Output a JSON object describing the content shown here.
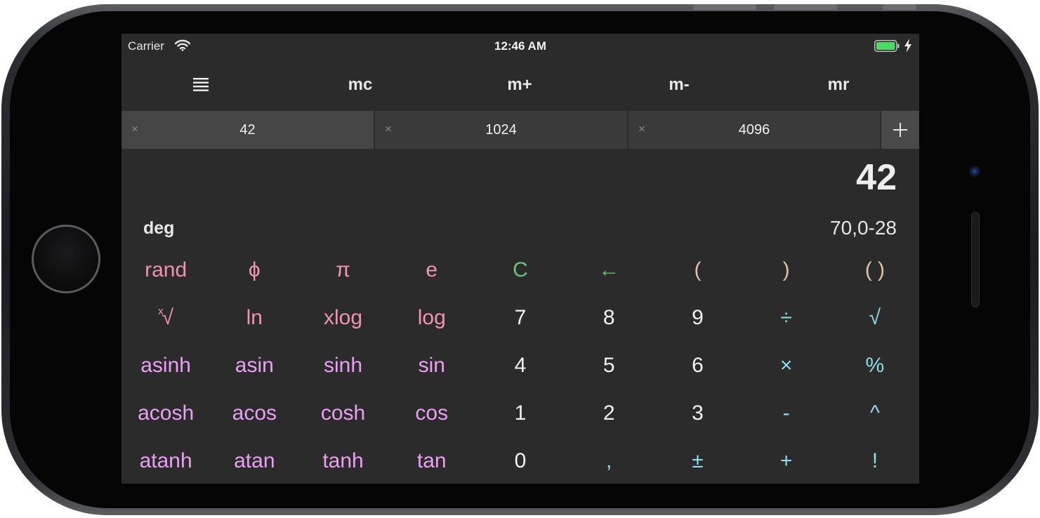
{
  "colors": {
    "function": "#f093b2",
    "trig": "#e9a0f2",
    "digit": "#f2f2f2",
    "operator": "#8cdde6",
    "clear": "#64c878",
    "paren": "#dcc4a4",
    "battery": "#4cd964"
  },
  "status_bar": {
    "carrier": "Carrier",
    "time": "12:46 AM",
    "wifi_icon": "wifi-icon",
    "battery_icon": "battery-charging-icon"
  },
  "toolbar": {
    "menu_icon": "menu-lines-icon",
    "items": [
      "mc",
      "m+",
      "m-",
      "mr"
    ]
  },
  "tabs": [
    {
      "label": "42",
      "close": "×"
    },
    {
      "label": "1024",
      "close": "×"
    },
    {
      "label": "4096",
      "close": "×"
    }
  ],
  "tab_add_icon": "plus-icon",
  "display": {
    "value": "42",
    "mode": "deg",
    "expression": "70,0-28"
  },
  "keypad": [
    [
      {
        "name": "rand",
        "label": "rand",
        "color": "function"
      },
      {
        "name": "phi",
        "label": "ϕ",
        "color": "function"
      },
      {
        "name": "pi",
        "label": "π",
        "color": "function"
      },
      {
        "name": "e",
        "label": "e",
        "color": "function"
      },
      {
        "name": "clear",
        "label": "C",
        "color": "clear"
      },
      {
        "name": "backspace",
        "label": "←",
        "color": "clear"
      },
      {
        "name": "open-paren",
        "label": "(",
        "color": "paren"
      },
      {
        "name": "close-paren",
        "label": ")",
        "color": "paren"
      },
      {
        "name": "parens",
        "label": "( )",
        "color": "paren"
      }
    ],
    [
      {
        "name": "xroot",
        "label": "√",
        "sup": "x",
        "color": "function"
      },
      {
        "name": "ln",
        "label": "ln",
        "color": "function"
      },
      {
        "name": "xlog",
        "label": "xlog",
        "color": "function"
      },
      {
        "name": "log",
        "label": "log",
        "color": "function"
      },
      {
        "name": "digit-7",
        "label": "7",
        "color": "digit"
      },
      {
        "name": "digit-8",
        "label": "8",
        "color": "digit"
      },
      {
        "name": "digit-9",
        "label": "9",
        "color": "digit"
      },
      {
        "name": "divide",
        "label": "÷",
        "color": "operator"
      },
      {
        "name": "sqrt",
        "label": "√",
        "color": "operator"
      }
    ],
    [
      {
        "name": "asinh",
        "label": "asinh",
        "color": "trig"
      },
      {
        "name": "asin",
        "label": "asin",
        "color": "trig"
      },
      {
        "name": "sinh",
        "label": "sinh",
        "color": "trig"
      },
      {
        "name": "sin",
        "label": "sin",
        "color": "trig"
      },
      {
        "name": "digit-4",
        "label": "4",
        "color": "digit"
      },
      {
        "name": "digit-5",
        "label": "5",
        "color": "digit"
      },
      {
        "name": "digit-6",
        "label": "6",
        "color": "digit"
      },
      {
        "name": "multiply",
        "label": "×",
        "color": "operator"
      },
      {
        "name": "percent",
        "label": "%",
        "color": "operator"
      }
    ],
    [
      {
        "name": "acosh",
        "label": "acosh",
        "color": "trig"
      },
      {
        "name": "acos",
        "label": "acos",
        "color": "trig"
      },
      {
        "name": "cosh",
        "label": "cosh",
        "color": "trig"
      },
      {
        "name": "cos",
        "label": "cos",
        "color": "trig"
      },
      {
        "name": "digit-1",
        "label": "1",
        "color": "digit"
      },
      {
        "name": "digit-2",
        "label": "2",
        "color": "digit"
      },
      {
        "name": "digit-3",
        "label": "3",
        "color": "digit"
      },
      {
        "name": "minus",
        "label": "-",
        "color": "operator"
      },
      {
        "name": "power",
        "label": "^",
        "color": "operator"
      }
    ],
    [
      {
        "name": "atanh",
        "label": "atanh",
        "color": "trig"
      },
      {
        "name": "atan",
        "label": "atan",
        "color": "trig"
      },
      {
        "name": "tanh",
        "label": "tanh",
        "color": "trig"
      },
      {
        "name": "tan",
        "label": "tan",
        "color": "trig"
      },
      {
        "name": "digit-0",
        "label": "0",
        "color": "digit"
      },
      {
        "name": "comma",
        "label": ",",
        "color": "operator"
      },
      {
        "name": "plus-minus",
        "label": "±",
        "color": "operator"
      },
      {
        "name": "plus",
        "label": "+",
        "color": "operator"
      },
      {
        "name": "factorial",
        "label": "!",
        "color": "operator"
      }
    ]
  ]
}
